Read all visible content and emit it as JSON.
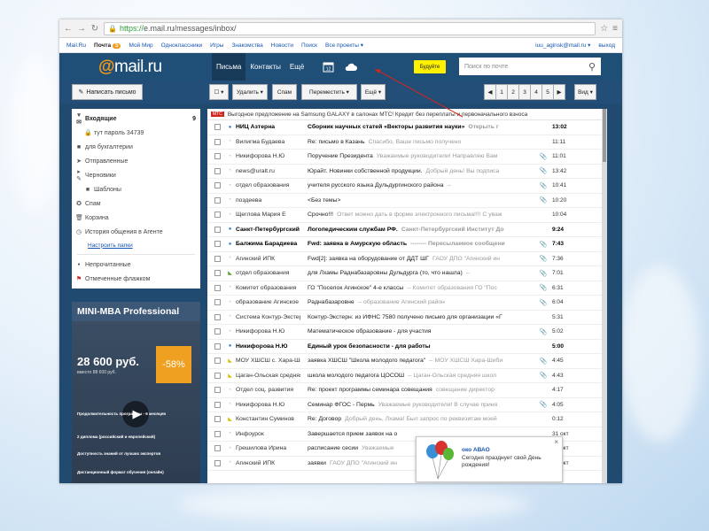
{
  "browser": {
    "url_scheme": "https://",
    "url_rest": "e.mail.ru/messages/inbox/"
  },
  "portal": {
    "items": [
      "Mail.Ru",
      "Почта",
      "Мой Мир",
      "Одноклассники",
      "Игры",
      "Знакомства",
      "Новости",
      "Поиск",
      "Все проекты ▾"
    ],
    "mail_badge": "5",
    "user": "iuu_aginsk@mail.ru ▾",
    "logout": "выход"
  },
  "header": {
    "logo_at": "@",
    "logo_text": "mail.ru",
    "tabs": [
      "Письма",
      "Контакты",
      "Ещё"
    ],
    "calendar_day": "12",
    "budilnik": "Будуйте",
    "search_placeholder": "Поиск по почте"
  },
  "toolbar": {
    "compose": "Написать письмо",
    "delete": "Удалить ▾",
    "spam": "Спам",
    "move": "Переместить ▾",
    "more": "Ещё ▾",
    "pages": [
      "◀",
      "1",
      "2",
      "3",
      "4",
      "5",
      "▶"
    ],
    "view": "Вид ▾"
  },
  "folders": [
    {
      "icon": "inbox-icon",
      "glyph": "▾ ✉",
      "label": "Входящие",
      "count": "9",
      "cls": "inbox"
    },
    {
      "icon": "lock-icon",
      "glyph": "🔒",
      "label": "тут пароль 34739",
      "count": "",
      "cls": "sub"
    },
    {
      "icon": "folder-icon",
      "glyph": "■",
      "label": "для бухгалтерии",
      "count": "",
      "cls": ""
    },
    {
      "icon": "sent-icon",
      "glyph": "➤",
      "label": "Отправленные",
      "count": "",
      "cls": ""
    },
    {
      "icon": "drafts-icon",
      "glyph": "▸ ✎",
      "label": "Черновики",
      "count": "",
      "cls": ""
    },
    {
      "icon": "folder-icon",
      "glyph": "■",
      "label": "Шаблоны",
      "count": "",
      "cls": "sub"
    },
    {
      "icon": "spam-icon",
      "glyph": "✪",
      "label": "Спам",
      "count": "",
      "cls": ""
    },
    {
      "icon": "trash-icon",
      "glyph": "🗑",
      "label": "Корзина",
      "count": "",
      "cls": ""
    },
    {
      "icon": "history-icon",
      "glyph": "◷",
      "label": "История общения в Агенте",
      "count": "",
      "cls": ""
    }
  ],
  "folders_settings": "Настроить папки",
  "filters": [
    {
      "icon": "unread-icon",
      "glyph": "●",
      "label": "Непрочитанные"
    },
    {
      "icon": "flag-icon",
      "glyph": "⚑",
      "label": "Отмеченные флажком"
    }
  ],
  "ad": {
    "title": "MINI-MBA Professional",
    "price": "28 600 руб.",
    "old_price": "вместо 88 600 руб.",
    "discount": "-58%",
    "bullets": [
      "Продолжительность программы - 6 месяцев",
      "2 диплома (российский и европейский)",
      "Доступность знаний от лучших экспертов",
      "Дистанционный формат обучения (онлайн)"
    ]
  },
  "promo": {
    "tag": "МТС",
    "text": "Выгодное предложение на Samsung GALAXY в салонах МТС! Кредит без переплаты и первоначального взноса"
  },
  "emails": [
    {
      "from": "НИЦ Азтерна",
      "subject": "Сборник научных статей «Векторы развития науки»",
      "snippet": "Открыть г",
      "date": "13:02",
      "unread": true,
      "mark": "dot",
      "attach": ""
    },
    {
      "from": "Вилигма Будаева",
      "subject": "Re: письмо в Казань",
      "snippet": "Спасибо, Ваше письмо получено",
      "date": "11:11",
      "unread": false,
      "mark": "",
      "attach": ""
    },
    {
      "from": "Никифорова Н.Ю",
      "subject": "Поручение Президента",
      "snippet": "Уважаемые руководители! Направляю Вам",
      "date": "11:01",
      "unread": false,
      "mark": "",
      "attach": "📎"
    },
    {
      "from": "news@uralt.ru",
      "subject": "Юрайт. Новинки собственной продукции.",
      "snippet": "Добрый день! Вы подписа",
      "date": "13:42",
      "unread": false,
      "mark": "",
      "attach": "📎"
    },
    {
      "from": "отдел образования",
      "subject": "учителя русского языка Дульдургинского района",
      "snippet": "--",
      "date": "10:41",
      "unread": false,
      "mark": "",
      "attach": "📎"
    },
    {
      "from": "поздеева",
      "subject": "<Без темы>",
      "snippet": "",
      "date": "10:20",
      "unread": false,
      "mark": "",
      "attach": "📎"
    },
    {
      "from": "Щеглова Мария Е",
      "subject": "Срочно!!!",
      "snippet": "Ответ можно дать в форме электронного письма!!!! С уваж",
      "date": "10:04",
      "unread": false,
      "mark": "",
      "attach": ""
    },
    {
      "from": "Санкт-Петербургский",
      "subject": "Логопедическим службам РФ.",
      "snippet": "Санкт-Петербургский Институт До",
      "date": "9:24",
      "unread": true,
      "mark": "dot",
      "attach": ""
    },
    {
      "from": "Балжима Барадиева",
      "subject": "Fwd: заявка в Амурскую область",
      "snippet": "-------- Пересылаемое сообщени",
      "date": "7:43",
      "unread": true,
      "mark": "dot",
      "attach": "📎"
    },
    {
      "from": "Агинский ИПК",
      "subject": "Fwd[2]: заявка на оборудование от ДДТ ШГ",
      "snippet": "ГАОУ ДПО \"Агинский ин",
      "date": "7:36",
      "unread": false,
      "mark": "",
      "attach": "📎"
    },
    {
      "from": "отдел образования",
      "subject": "для Лхамы Раднабазаровны Дульдурга (то, что нашла)",
      "snippet": "--",
      "date": "7:01",
      "unread": false,
      "mark": "flag-g",
      "attach": "📎"
    },
    {
      "from": "Комитет образования",
      "subject": "ГО \"Поселок Агинское\" 4-е классы",
      "snippet": "-- Комитет образования ГО \"Пос",
      "date": "6:31",
      "unread": false,
      "mark": "",
      "attach": "📎"
    },
    {
      "from": "образование Агинское",
      "subject": "Раднабазаровне",
      "snippet": "-- образование Агинский район",
      "date": "6:04",
      "unread": false,
      "mark": "",
      "attach": "📎"
    },
    {
      "from": "Система Контур-Экстерн",
      "subject": "Контур-Экстерн: из ИФНС 7580 получено письмо для организации «Г",
      "snippet": "",
      "date": "5:31",
      "unread": false,
      "mark": "",
      "attach": ""
    },
    {
      "from": "Никифорова Н.Ю",
      "subject": "Математическое образование - для участия",
      "snippet": "",
      "date": "5:02",
      "unread": false,
      "mark": "",
      "attach": "📎"
    },
    {
      "from": "Никифорова Н.Ю",
      "subject": "Единый урок безопасности - для работы",
      "snippet": "",
      "date": "5:00",
      "unread": true,
      "mark": "dot",
      "attach": ""
    },
    {
      "from": "МОУ ХШСШ с. Хара-Шибирь",
      "subject": "заявка ХШСШ \"Школа молодого педагога\"",
      "snippet": "-- МОУ ХШСШ Хара-Шиби",
      "date": "4:45",
      "unread": false,
      "mark": "flag-y",
      "attach": "📎"
    },
    {
      "from": "Цаган-Ольская средняя",
      "subject": "школа молодого педагога ЦОСОШ",
      "snippet": "-- Цаган-Ольская средняя школ",
      "date": "4:43",
      "unread": false,
      "mark": "flag-y",
      "attach": "📎"
    },
    {
      "from": "Отдел соц. развития",
      "subject": "Re: проект программы семинара совещания",
      "snippet": "совещание директор",
      "date": "4:17",
      "unread": false,
      "mark": "",
      "attach": ""
    },
    {
      "from": "Никифорова Н.Ю",
      "subject": "Семинар ФГОС - Пермь",
      "snippet": "Уважаемые руководители! В случае приня",
      "date": "4:05",
      "unread": false,
      "mark": "",
      "attach": "📎"
    },
    {
      "from": "Константин Суминов",
      "subject": "Re: Договор",
      "snippet": "Добрый день, Лхама! Был запрос по реквизитам моей",
      "date": "0:12",
      "unread": false,
      "mark": "flag-y",
      "attach": ""
    },
    {
      "from": "Инфоурок",
      "subject": "Завершается прием заявок на о",
      "snippet": "",
      "date": "31 окт",
      "unread": false,
      "mark": "",
      "attach": ""
    },
    {
      "from": "Грешилова Ирина",
      "subject": "расписание сесии",
      "snippet": "Уважаемые",
      "date": "31 окт",
      "unread": false,
      "mark": "",
      "attach": ""
    },
    {
      "from": "Агинский ИПК",
      "subject": "заявки",
      "snippet": "ГАОУ ДПО \"Агинский ин",
      "date": "31 окт",
      "unread": false,
      "mark": "",
      "attach": ""
    }
  ],
  "notification": {
    "title": "око АВАО",
    "text": "Сегодня празднует свой День рождения!"
  },
  "colors": {
    "header": "#1f4e76",
    "accent_orange": "#f39b1b",
    "budilnik": "#fff100",
    "link": "#1656b0"
  }
}
